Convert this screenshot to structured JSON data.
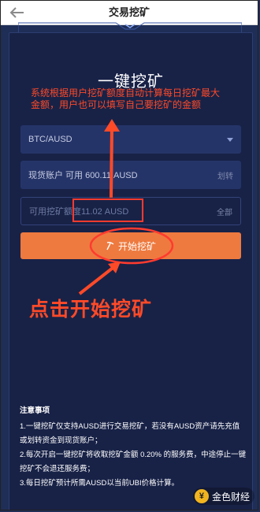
{
  "header": {
    "title": "交易挖矿",
    "back_icon": "arrow-left-icon"
  },
  "main": {
    "title": "一键挖矿",
    "pair_select": {
      "value": "BTC/AUSD"
    },
    "spot_account": {
      "label": "现货账户 可用 600.11 AUSD",
      "action": "划转"
    },
    "mining_limit": {
      "label": "可用挖矿额度11.02 AUSD",
      "action": "全部"
    },
    "start_button": {
      "label": "开始挖矿",
      "icon": "pickaxe-icon"
    }
  },
  "annotations": {
    "top_note": "系统根据用户挖矿额度自动计算每日挖矿最大金额，用户也可以填写自己要挖矿的金额",
    "bottom_callout": "点击开始挖矿",
    "color": "#ff4a28"
  },
  "notes": {
    "title": "注意事项",
    "items": [
      "1.一键挖矿仅支持AUSD进行交易挖矿，若没有AUSD资产请先充值或划转资金到现货账户；",
      "2.每次开启一键挖矿将收取挖矿金额 0.20% 的服务费，中途停止一键挖矿不会退还服务费；",
      "3.每日挖矿预计所需AUSD以当前UBI价格计算。"
    ]
  },
  "watermark": {
    "text": "金色财经",
    "icon": "coin-logo-icon"
  },
  "colors": {
    "background": "#1f2e57",
    "card": "#182247",
    "button": "#ee7a3f",
    "header": "#ffffff"
  }
}
